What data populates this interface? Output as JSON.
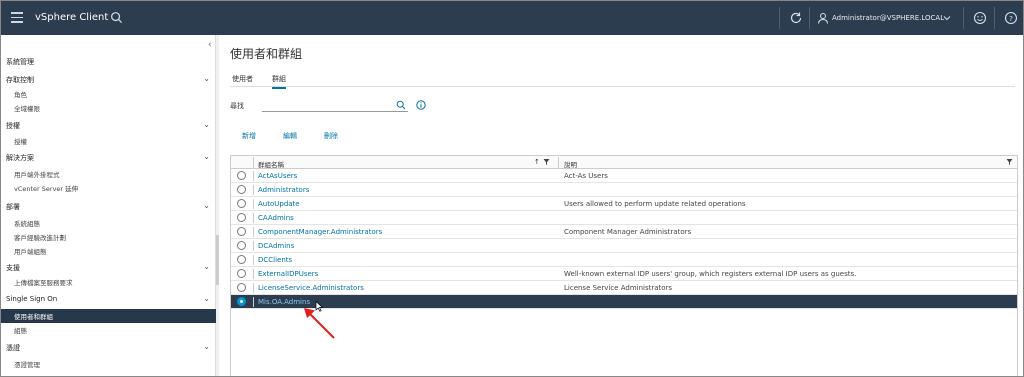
{
  "header": {
    "app_title": "vSphere Client",
    "user": "Administrator@VSPHERE.LOCAL"
  },
  "sidebar": {
    "items": [
      {
        "label": "系統管理",
        "level": 0,
        "chevron": false
      },
      {
        "label": "存取控制",
        "level": 0,
        "chevron": true
      },
      {
        "label": "角色",
        "level": 1
      },
      {
        "label": "全域權限",
        "level": 1
      },
      {
        "label": "授權",
        "level": 0,
        "chevron": true
      },
      {
        "label": "授權",
        "level": 1
      },
      {
        "label": "解決方案",
        "level": 0,
        "chevron": true
      },
      {
        "label": "用戶端外掛程式",
        "level": 1
      },
      {
        "label": "vCenter Server 延伸",
        "level": 1
      },
      {
        "label": "部署",
        "level": 0,
        "chevron": true
      },
      {
        "label": "系統組態",
        "level": 1
      },
      {
        "label": "客戶經驗改進計劃",
        "level": 1
      },
      {
        "label": "用戶端組態",
        "level": 1
      },
      {
        "label": "支援",
        "level": 0,
        "chevron": true
      },
      {
        "label": "上傳檔案至服務要求",
        "level": 1
      },
      {
        "label": "Single Sign On",
        "level": 0,
        "chevron": true
      },
      {
        "label": "使用者和群組",
        "level": 1,
        "active": true
      },
      {
        "label": "組態",
        "level": 1
      },
      {
        "label": "憑證",
        "level": 0,
        "chevron": true
      },
      {
        "label": "憑證管理",
        "level": 1
      }
    ]
  },
  "main": {
    "title": "使用者和群組",
    "tabs": [
      {
        "label": "使用者",
        "active": false
      },
      {
        "label": "群組",
        "active": true
      }
    ],
    "search_label": "尋找",
    "search_value": "",
    "actions": {
      "new": "新增",
      "edit": "編輯",
      "delete": "刪除"
    }
  },
  "grid": {
    "columns": [
      "群組名稱",
      "說明"
    ],
    "rows": [
      {
        "name": "ActAsUsers",
        "desc": "Act-As Users",
        "selected": false
      },
      {
        "name": "Administrators",
        "desc": "",
        "selected": false
      },
      {
        "name": "AutoUpdate",
        "desc": "Users allowed to perform update related operations",
        "selected": false
      },
      {
        "name": "CAAdmins",
        "desc": "",
        "selected": false
      },
      {
        "name": "ComponentManager.Administrators",
        "desc": "Component Manager Administrators",
        "selected": false
      },
      {
        "name": "DCAdmins",
        "desc": "",
        "selected": false
      },
      {
        "name": "DCClients",
        "desc": "",
        "selected": false
      },
      {
        "name": "ExternalIDPUsers",
        "desc": "Well-known external IDP users' group, which registers external IDP users as guests.",
        "selected": false
      },
      {
        "name": "LicenseService.Administrators",
        "desc": "License Service Administrators",
        "selected": false
      },
      {
        "name": "Mis.OA.Admins",
        "desc": "",
        "selected": true
      }
    ]
  },
  "colors": {
    "header_bg": "#2b3d4f",
    "link": "#0072a3",
    "selected_row": "#2b3d4f",
    "annotation_arrow": "#e02020"
  }
}
